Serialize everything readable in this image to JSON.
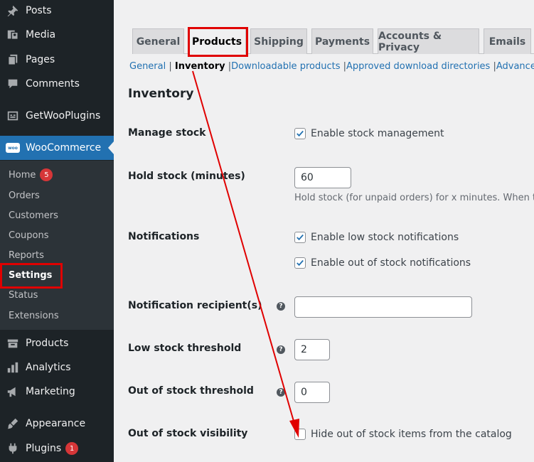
{
  "sidebar": {
    "items": [
      {
        "label": "Posts",
        "icon": "pin-icon"
      },
      {
        "label": "Media",
        "icon": "media-icon"
      },
      {
        "label": "Pages",
        "icon": "pages-icon"
      },
      {
        "label": "Comments",
        "icon": "comments-icon"
      },
      {
        "label": "GetWooPlugins",
        "icon": "plugin-icon"
      },
      {
        "label": "WooCommerce",
        "icon": "woo-icon"
      },
      {
        "label": "Products",
        "icon": "products-icon"
      },
      {
        "label": "Analytics",
        "icon": "analytics-icon"
      },
      {
        "label": "Marketing",
        "icon": "marketing-icon"
      },
      {
        "label": "Appearance",
        "icon": "brush-icon"
      },
      {
        "label": "Plugins",
        "icon": "plugins-icon",
        "badge": "1"
      }
    ],
    "woo_icon_text": "woo",
    "submenu": [
      {
        "label": "Home",
        "badge": "5"
      },
      {
        "label": "Orders"
      },
      {
        "label": "Customers"
      },
      {
        "label": "Coupons"
      },
      {
        "label": "Reports"
      },
      {
        "label": "Settings",
        "current": true
      },
      {
        "label": "Status"
      },
      {
        "label": "Extensions"
      }
    ]
  },
  "tabs": [
    "General",
    "Products",
    "Shipping",
    "Payments",
    "Accounts & Privacy",
    "Emails"
  ],
  "active_tab": "Products",
  "subnav": {
    "general": "General",
    "inventory": "Inventory",
    "downloadable": "Downloadable products",
    "approved": "Approved download directories",
    "advanced": "Advanced",
    "sep": "|"
  },
  "section_title": "Inventory",
  "fields": {
    "manage_stock": {
      "label": "Manage stock",
      "checkbox": "Enable stock management",
      "checked": true
    },
    "hold_stock": {
      "label": "Hold stock (minutes)",
      "value": "60",
      "description": "Hold stock (for unpaid orders) for x minutes. When this"
    },
    "notifications": {
      "label": "Notifications",
      "low": "Enable low stock notifications",
      "out": "Enable out of stock notifications",
      "low_checked": true,
      "out_checked": true
    },
    "recipient": {
      "label": "Notification recipient(s)",
      "value": ""
    },
    "low_threshold": {
      "label": "Low stock threshold",
      "value": "2"
    },
    "out_threshold": {
      "label": "Out of stock threshold",
      "value": "0"
    },
    "visibility": {
      "label": "Out of stock visibility",
      "checkbox": "Hide out of stock items from the catalog",
      "checked": false
    }
  },
  "help_glyph": "?",
  "colors": {
    "accent": "#2271b1",
    "highlight": "#e00000",
    "sidebar": "#1d2327",
    "badge": "#d63638"
  }
}
